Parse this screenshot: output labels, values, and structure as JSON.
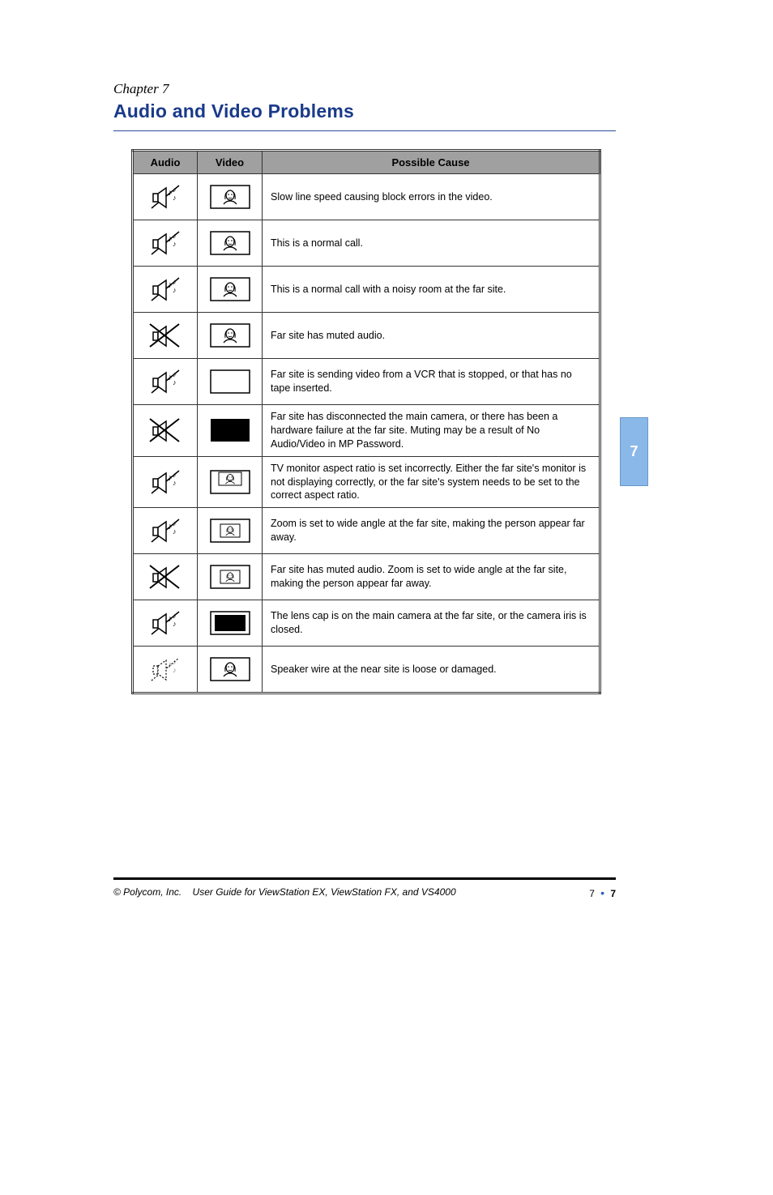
{
  "chapter_label": "Chapter 7",
  "heading": "Audio and Video Problems",
  "side_tab": "7",
  "footer": {
    "doc_title": "User Guide for ViewStation EX, ViewStation FX, and VS4000",
    "copyright": "© Polycom, Inc.",
    "page_prefix": "7",
    "page_num": "7"
  },
  "columns": [
    "Audio",
    "Video",
    "Possible Cause"
  ],
  "rows": [
    {
      "audio": "on",
      "video": "person_noisy",
      "cause": "Slow line speed causing block errors in the video."
    },
    {
      "audio": "on",
      "video": "person_clear",
      "cause": "This is a normal call."
    },
    {
      "audio": "on",
      "video": "person_noisy",
      "cause": "This is a normal call with a noisy room at the far site."
    },
    {
      "audio": "off",
      "video": "person_clear",
      "cause": "Far site has muted audio."
    },
    {
      "audio": "on",
      "video": "blank_noisy",
      "cause": "Far site is sending video from a VCR that is stopped, or that has no tape inserted."
    },
    {
      "audio": "off",
      "video": "black",
      "cause": "Far site has disconnected the main camera, or there has been a hardware failure at the far site. Muting may be a result of No Audio/Video in MP Password."
    },
    {
      "audio": "on",
      "video": "person_small_top",
      "cause": "TV monitor aspect ratio is set incorrectly. Either the far site's monitor is not displaying correctly, or the far site's system needs to be set to the correct aspect ratio."
    },
    {
      "audio": "on",
      "video": "person_small_center",
      "cause": "Zoom is set to wide angle at the far site, making the person appear far away."
    },
    {
      "audio": "off",
      "video": "person_small_center",
      "cause": "Far site has muted audio. Zoom is set to wide angle at the far site, making the person appear far away."
    },
    {
      "audio": "on",
      "video": "black_framed",
      "cause": "The lens cap is on the main camera at the far site, or the camera iris is closed."
    },
    {
      "audio": "fading",
      "video": "person_clear",
      "cause": "Speaker wire at the near site is loose or damaged."
    }
  ]
}
